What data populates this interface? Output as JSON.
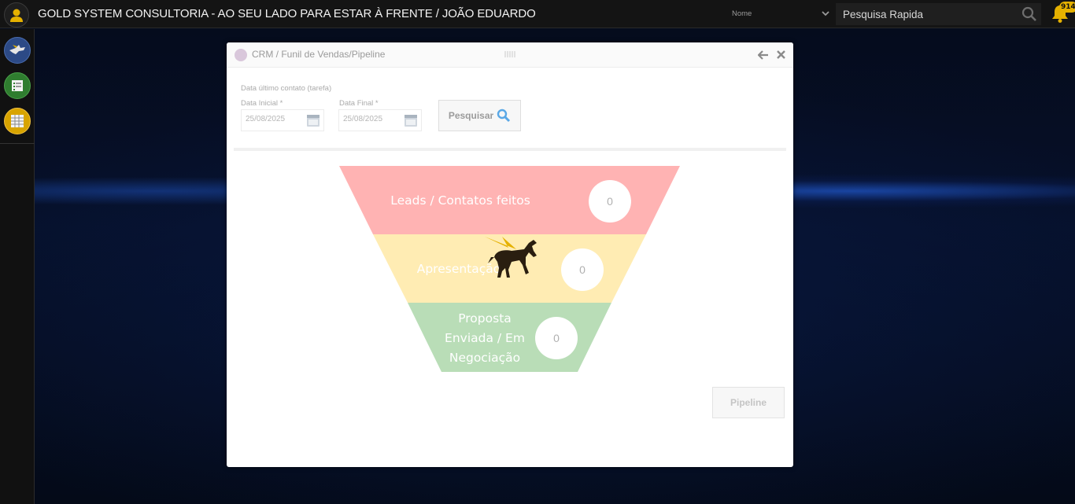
{
  "header": {
    "title": "GOLD SYSTEM CONSULTORIA - AO SEU LADO PARA ESTAR À FRENTE / JOÃO EDUARDO",
    "search_type": "Nome",
    "search_placeholder": "Pesquisa Rapida",
    "notification_count": "914"
  },
  "sidebar": {
    "items": [
      {
        "icon": "pegasus-icon",
        "color": "#2c4a86"
      },
      {
        "icon": "list-icon",
        "color": "#2f7d2f"
      },
      {
        "icon": "grid-icon",
        "color": "#d8a400"
      }
    ]
  },
  "modal": {
    "title": "CRM / Funil de Vendas/Pipeline",
    "filter": {
      "section_label": "Data último contato (tarefa)",
      "start_label": "Data Inicial *",
      "start_value": "25/08/2025",
      "end_label": "Data Final *",
      "end_value": "25/08/2025",
      "search_button": "Pesquisar"
    },
    "funnel": [
      {
        "label": "Leads / Contatos feitos",
        "count": "0",
        "color": "#ffb3b3"
      },
      {
        "label": "Apresentação",
        "count": "0",
        "color": "#ffecb3"
      },
      {
        "label": "Proposta Enviada / Em Negociação",
        "count": "0",
        "color": "#b9ddb7"
      }
    ],
    "pipeline_button": "Pipeline"
  }
}
